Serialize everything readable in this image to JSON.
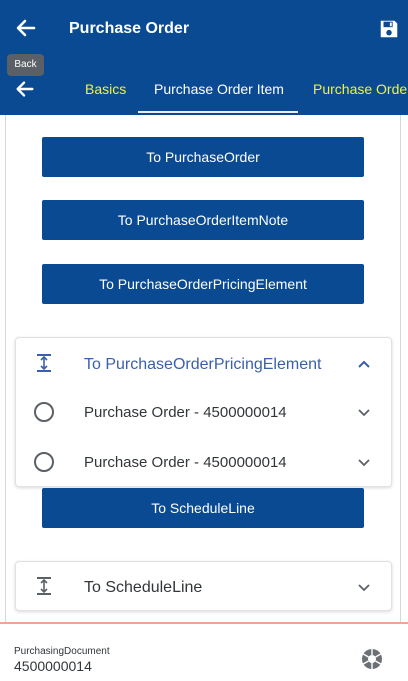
{
  "header": {
    "title": "Purchase Order",
    "back_icon": "arrow-left-icon",
    "save_icon": "floppy-disk-icon"
  },
  "tooltip": {
    "text": "Back"
  },
  "tabs": [
    {
      "label": "Basics"
    },
    {
      "label": "Purchase Order Item"
    },
    {
      "label": "Purchase Order Pricing Element"
    }
  ],
  "buttons": {
    "to_purchase_order": "To PurchaseOrder",
    "to_item_note": "To PurchaseOrderItemNote",
    "to_pricing_element": "To PurchaseOrderPricingElement",
    "to_schedule_line": "To ScheduleLine"
  },
  "pricing_panel": {
    "title": "To PurchaseOrderPricingElement",
    "rows": [
      {
        "label": "Purchase Order - 4500000014"
      },
      {
        "label": "Purchase Order - 4500000014"
      }
    ]
  },
  "schedule_panel": {
    "title": "To ScheduleLine"
  },
  "field": {
    "label": "PurchasingDocument",
    "value": "4500000014"
  },
  "colors": {
    "primary": "#0a4a92",
    "tab_accent": "#ecf63a",
    "link_text": "#3a5fae",
    "divider": "#f0a58f"
  }
}
